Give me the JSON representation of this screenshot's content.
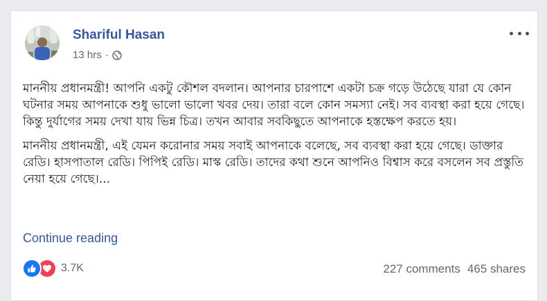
{
  "post": {
    "author": "Shariful Hasan",
    "time": "13 hrs",
    "separator": "·",
    "privacy_icon": "globe-icon",
    "menu_icon": "more-options-icon",
    "paragraphs": [
      "মাননীয় প্রধানমন্ত্রী! আপনি একটু কৌশল বদলান। আপনার চারপাশে একটা চক্র গড়ে উঠেছে যারা যে কোন ঘটনার সময় আপনাকে শুধু ভালো ভালো খবর দেয়। তারা বলে কোন সমস্যা নেই। সব ব্যবস্থা করা হয়ে গেছে। কিন্তু দুর্যাগের সময় দেখা যায় ভিন্ন চিত্র। তখন আবার সবকিছুতে আপনাকে হস্তক্ষেপ করতে হয়।",
      "মাননীয় প্রধানমন্ত্রী, এই যেমন করোনার সময় সবাই আপনাকে বলেছে, সব ব্যবস্থা করা হয়ে গেছে। ডাক্তার রেডি। হাসপাতাল রেডি। পিপিই রেডি। মাস্ক রেডি। তাদের কথা শুনে আপনিও বিশ্বাস করে বসলেন সব প্রস্তুতি নেয়া হয়ে গেছে।..."
    ],
    "continue_label": "Continue reading",
    "reactions": {
      "count": "3.7K",
      "icons": [
        "like-icon",
        "love-icon"
      ]
    },
    "comments": "227 comments",
    "shares": "465 shares"
  },
  "colors": {
    "link": "#365899",
    "muted": "#606770",
    "like": "#1877f2",
    "love": "#f33e58"
  }
}
